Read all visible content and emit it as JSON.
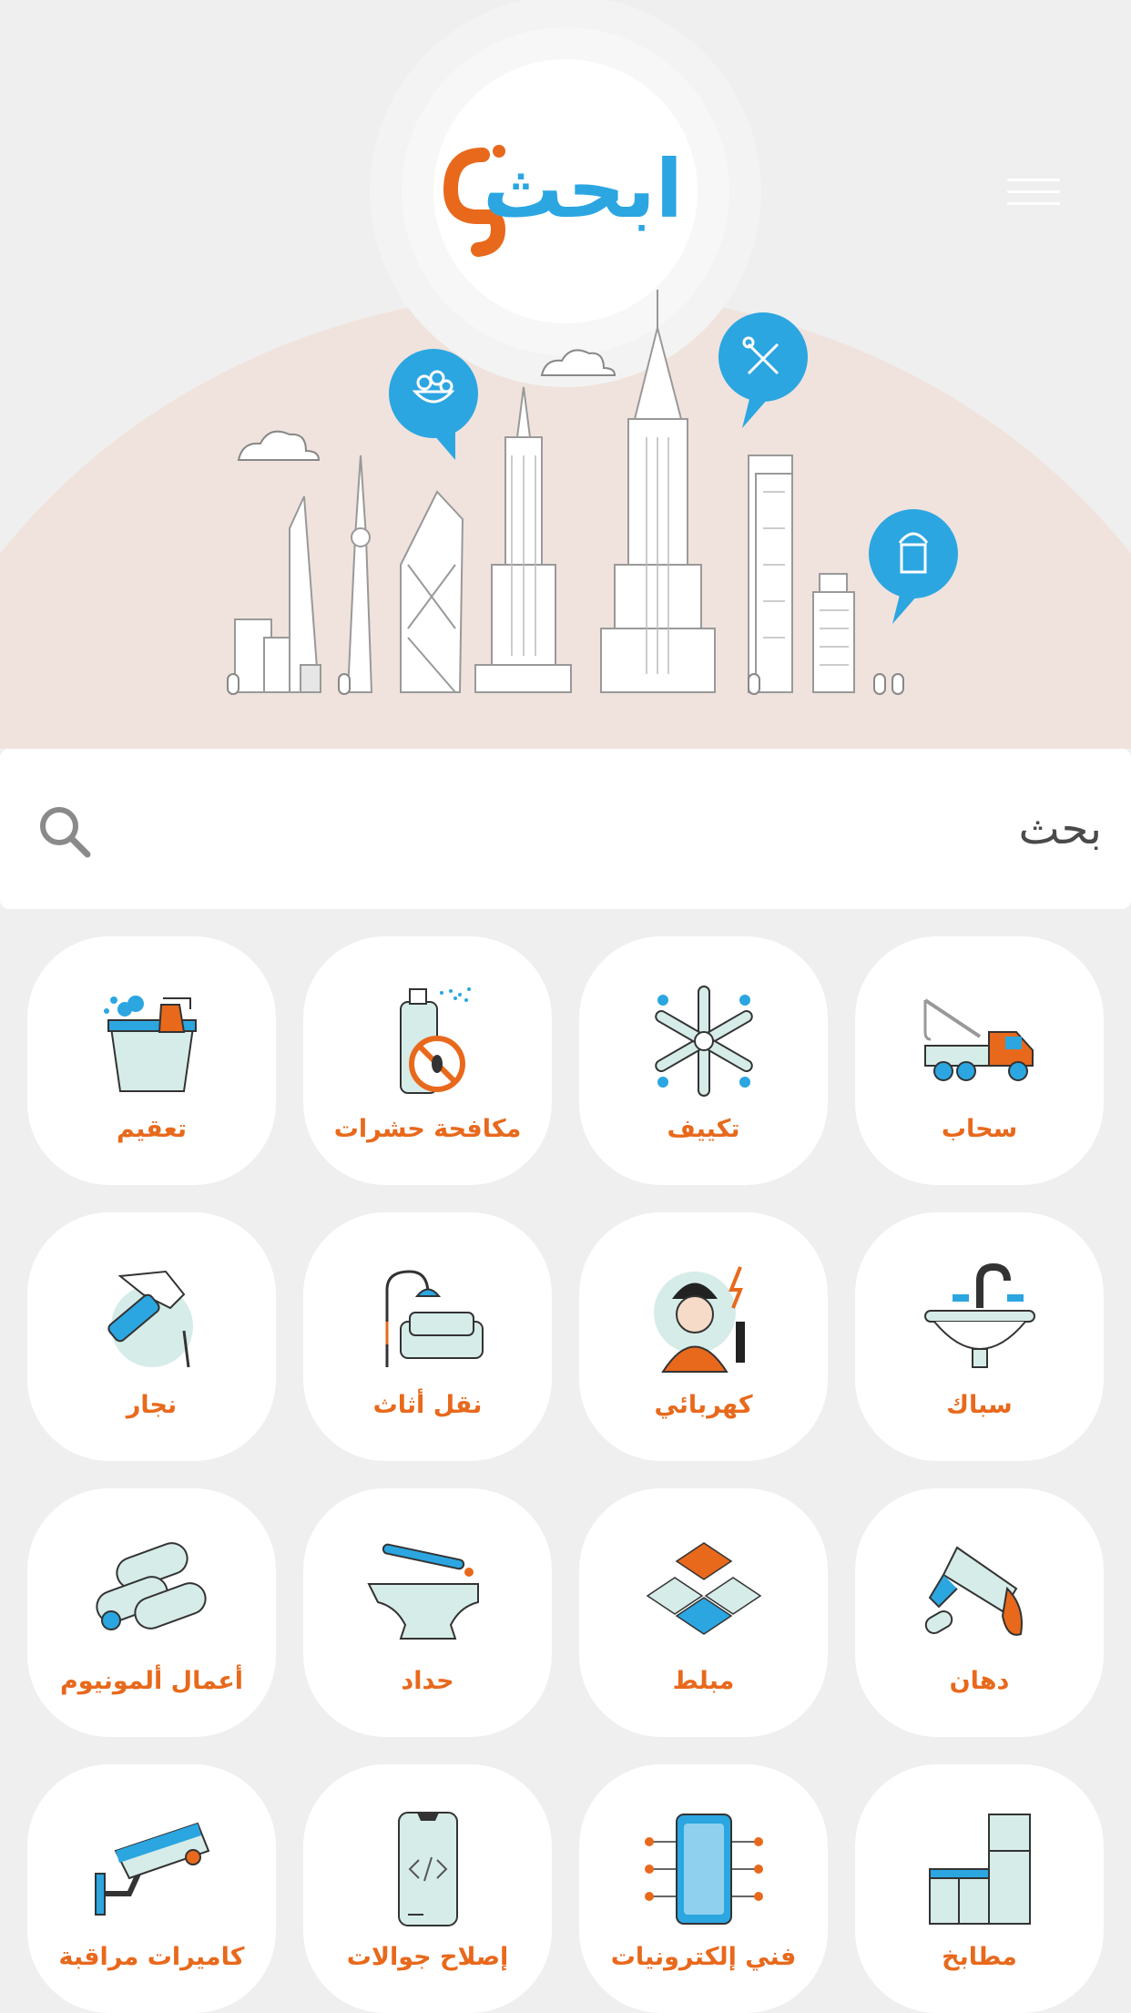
{
  "app": {
    "logo_text": "ابحثلي",
    "colors": {
      "brand_blue": "#2ba6e1",
      "brand_orange": "#e8691c",
      "hero_bg": "#f0e3dd",
      "page_bg": "#efefef"
    }
  },
  "header": {
    "menu_icon": "hamburger-menu-icon"
  },
  "search": {
    "placeholder": "بحث",
    "icon": "search-icon"
  },
  "categories": [
    {
      "label": "سحاب",
      "icon": "tow-truck-icon"
    },
    {
      "label": "تكييف",
      "icon": "snowflake-icon"
    },
    {
      "label": "مكافحة حشرات",
      "icon": "pest-spray-icon"
    },
    {
      "label": "تعقيم",
      "icon": "cleaning-bucket-icon"
    },
    {
      "label": "سباك",
      "icon": "sink-faucet-icon"
    },
    {
      "label": "كهربائي",
      "icon": "electrician-icon"
    },
    {
      "label": "نقل أثاث",
      "icon": "sofa-lamp-icon"
    },
    {
      "label": "نجار",
      "icon": "hammer-icon"
    },
    {
      "label": "دهان",
      "icon": "paint-brush-icon"
    },
    {
      "label": "مبلط",
      "icon": "floor-tiles-icon"
    },
    {
      "label": "حداد",
      "icon": "anvil-icon"
    },
    {
      "label": "أعمال ألمونيوم",
      "icon": "aluminum-pipes-icon"
    },
    {
      "label": "مطابخ",
      "icon": "kitchen-cabinet-icon"
    },
    {
      "label": "فني إلكترونيات",
      "icon": "circuit-phone-icon"
    },
    {
      "label": "إصلاح جوالات",
      "icon": "mobile-phone-icon"
    },
    {
      "label": "كاميرات مراقبة",
      "icon": "security-camera-icon"
    }
  ]
}
